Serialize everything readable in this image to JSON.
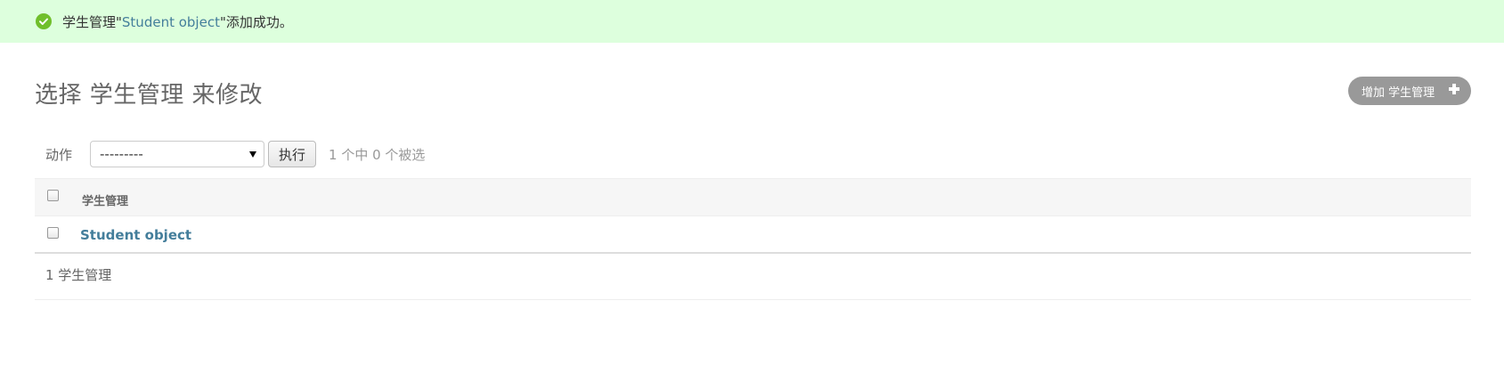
{
  "message": {
    "prefix": "学生管理\"",
    "link_text": "Student object",
    "suffix": "\"添加成功。",
    "icon": "check-circle-icon",
    "color": "#70bf2b",
    "background": "#ddffdd"
  },
  "page": {
    "title": "选择 学生管理 来修改",
    "add_button_label": "增加 学生管理"
  },
  "actions": {
    "label": "动作",
    "select_value": "---------",
    "go_label": "执行",
    "selection_count": "1 个中 0 个被选"
  },
  "table": {
    "column_header": "学生管理",
    "rows": [
      {
        "label": "Student object"
      }
    ]
  },
  "paginator": {
    "text": "1 学生管理"
  },
  "colors": {
    "link": "#447e9b",
    "add_button": "#999999"
  }
}
